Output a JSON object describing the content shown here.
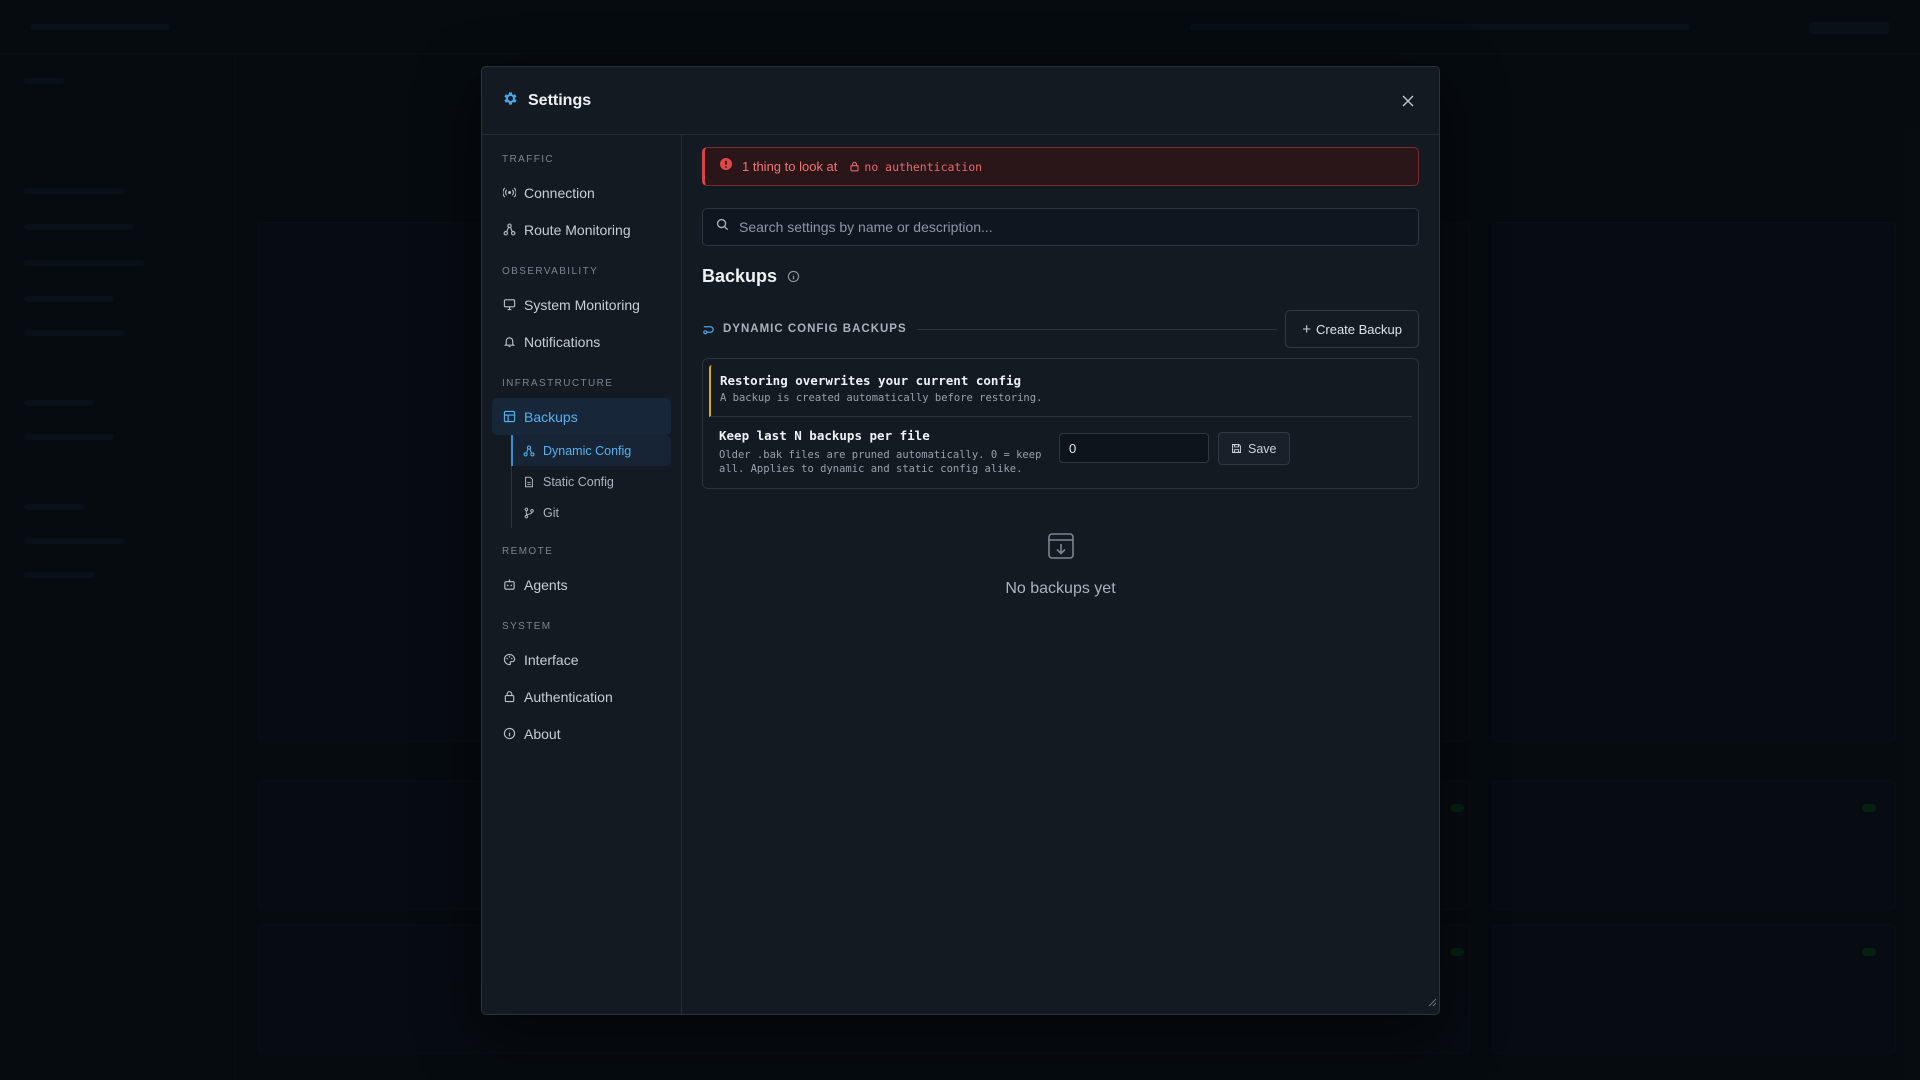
{
  "modal": {
    "title": "Settings",
    "close_icon": "close-icon"
  },
  "nav": {
    "sections": [
      {
        "label": "TRAFFIC",
        "items": [
          {
            "label": "Connection",
            "icon": "broadcast-icon"
          },
          {
            "label": "Route Monitoring",
            "icon": "route-icon"
          }
        ]
      },
      {
        "label": "OBSERVABILITY",
        "items": [
          {
            "label": "System Monitoring",
            "icon": "monitor-icon"
          },
          {
            "label": "Notifications",
            "icon": "bell-icon"
          }
        ]
      },
      {
        "label": "INFRASTRUCTURE",
        "items": [
          {
            "label": "Backups",
            "icon": "backup-icon",
            "active": true
          }
        ]
      },
      {
        "label": "REMOTE",
        "items": [
          {
            "label": "Agents",
            "icon": "agent-icon"
          }
        ]
      },
      {
        "label": "SYSTEM",
        "items": [
          {
            "label": "Interface",
            "icon": "palette-icon"
          },
          {
            "label": "Authentication",
            "icon": "lock-icon"
          },
          {
            "label": "About",
            "icon": "info-icon"
          }
        ]
      }
    ],
    "backup_subitems": [
      {
        "label": "Dynamic Config",
        "icon": "route-icon",
        "active": true
      },
      {
        "label": "Static Config",
        "icon": "file-icon"
      },
      {
        "label": "Git",
        "icon": "git-branch-icon"
      }
    ]
  },
  "alert": {
    "text": "1 thing to look at",
    "tag": "no authentication",
    "color": "#f27474"
  },
  "search": {
    "placeholder": "Search settings by name or description..."
  },
  "page": {
    "title": "Backups"
  },
  "section": {
    "label": "DYNAMIC CONFIG BACKUPS",
    "create_button": "Create Backup"
  },
  "warning": {
    "title": "Restoring overwrites your current config",
    "subtitle": "A backup is created automatically before restoring.",
    "color": "#d4a72c"
  },
  "keep_setting": {
    "name": "Keep last N backups per file",
    "description": "Older .bak files are pruned automatically. 0 = keep all. Applies to dynamic and static config alike.",
    "value": "0",
    "save_label": "Save"
  },
  "empty_state": {
    "text": "No backups yet"
  },
  "colors": {
    "accent": "#58b2f0",
    "danger": "#d64545"
  }
}
